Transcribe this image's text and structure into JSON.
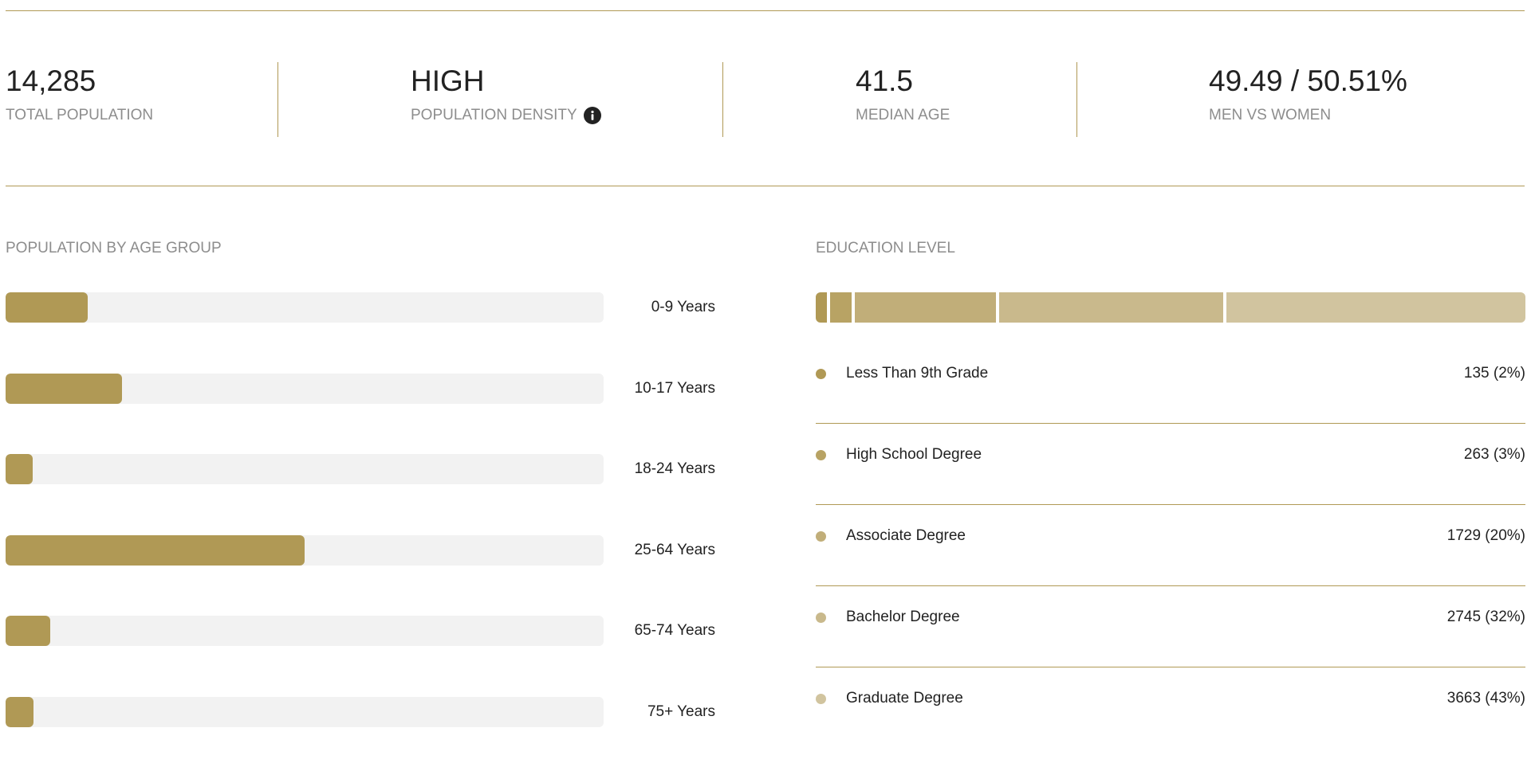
{
  "colors": {
    "accent": "#b09955",
    "track": "#f2f2f2",
    "label_gray": "#8d8d8d",
    "text": "#222222",
    "education_shades": [
      "#b09955",
      "#b8a364",
      "#c1ae79",
      "#c9b98c",
      "#d1c49f"
    ]
  },
  "stats": [
    {
      "value": "14,285",
      "label": "TOTAL POPULATION"
    },
    {
      "value": "HIGH",
      "label": "POPULATION DENSITY",
      "icon": "info-icon"
    },
    {
      "value": "41.5",
      "label": "MEDIAN AGE"
    },
    {
      "value": "49.49 / 50.51%",
      "label": "MEN VS WOMEN"
    }
  ],
  "age_section": {
    "title": "POPULATION BY AGE GROUP",
    "groups": [
      {
        "label": "0-9 Years",
        "share": 0.137
      },
      {
        "label": "10-17 Years",
        "share": 0.194
      },
      {
        "label": "18-24 Years",
        "share": 0.045
      },
      {
        "label": "25-64 Years",
        "share": 0.5
      },
      {
        "label": "65-74 Years",
        "share": 0.075
      },
      {
        "label": "75+ Years",
        "share": 0.046
      }
    ]
  },
  "education_section": {
    "title": "EDUCATION LEVEL",
    "levels": [
      {
        "name": "Less Than 9th Grade",
        "count": 135,
        "value_text": "135 (2%)"
      },
      {
        "name": "High School Degree",
        "count": 263,
        "value_text": "263 (3%)"
      },
      {
        "name": "Associate Degree",
        "count": 1729,
        "value_text": "1729 (20%)"
      },
      {
        "name": "Bachelor Degree",
        "count": 2745,
        "value_text": "2745 (32%)"
      },
      {
        "name": "Graduate Degree",
        "count": 3663,
        "value_text": "3663 (43%)"
      }
    ]
  }
}
